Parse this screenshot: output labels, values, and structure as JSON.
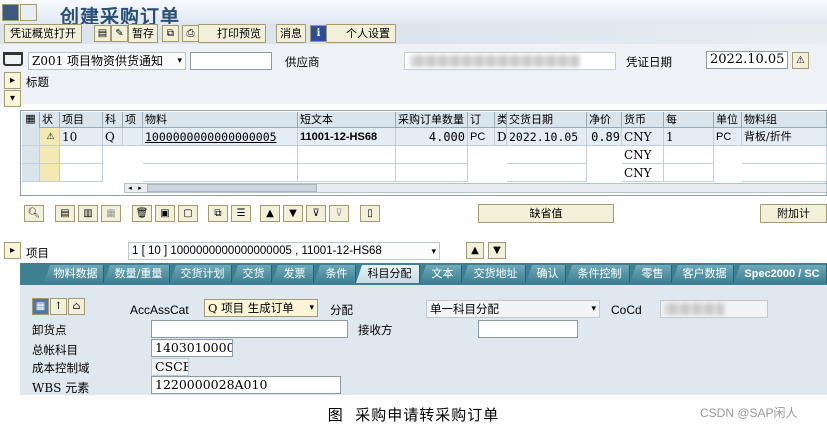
{
  "title": "创建采购订单",
  "toolbar": {
    "overview": "凭证概览打开",
    "hold": "暂存",
    "print_preview": "打印预览",
    "messages": "消息",
    "personal": "个人设置"
  },
  "header": {
    "doc_type": "Z001 项目物资供货通知",
    "vendor_label": "供应商",
    "doc_date_label": "凭证日期",
    "doc_date": "2022.10.05",
    "title_label": "标题"
  },
  "grid": {
    "headers": [
      "状",
      "项目",
      "科",
      "项",
      "物料",
      "短文本",
      "采购订单数量",
      "订",
      "类",
      "交货日期",
      "净价",
      "货币",
      "每",
      "单位",
      "物料组"
    ],
    "rows": [
      {
        "item": "10",
        "acct": "Q",
        "material": "1000000000000000005",
        "short_text": "11001-12-HS68",
        "qty": "4.000",
        "unit": "PC",
        "cat": "D",
        "date": "2022.10.05",
        "price": "0.89",
        "currency": "CNY",
        "per": "1",
        "order_unit": "PC",
        "group": "背板/折件"
      },
      {
        "currency": "CNY"
      },
      {
        "currency": "CNY"
      }
    ]
  },
  "actions": {
    "default_values": "缺省值",
    "additional": "附加计"
  },
  "item_detail": {
    "label": "项目",
    "selector": "1 [ 10 ] 1000000000000000005 , 11001-12-HS68"
  },
  "tabs": [
    "物料数据",
    "数量/重量",
    "交货计划",
    "交货",
    "发票",
    "条件",
    "科目分配",
    "文本",
    "交货地址",
    "确认",
    "条件控制",
    "零售",
    "客户数据",
    "Spec2000 / SC"
  ],
  "acct": {
    "acc_ass_cat_label": "AccAssCat",
    "acc_ass_cat": "Q 项目 生成订单",
    "distribution_label": "分配",
    "distribution": "单一科目分配",
    "coco_label": "CoCd",
    "unloading_label": "卸货点",
    "recipient_label": "接收方",
    "gl_label": "总帐科目",
    "gl": "1403010000",
    "co_area_label": "成本控制域",
    "co_area": "CSCE",
    "wbs_label": "WBS 元素",
    "wbs": "1220000028A010"
  },
  "caption": "图  采购申请转采购订单",
  "watermark": "CSDN @SAP闲人",
  "colors": {
    "frame": "#d6dde5",
    "tab_strip": "#3f7f92",
    "button": "#f3f0da",
    "grid_header": "#d9e4ec"
  }
}
